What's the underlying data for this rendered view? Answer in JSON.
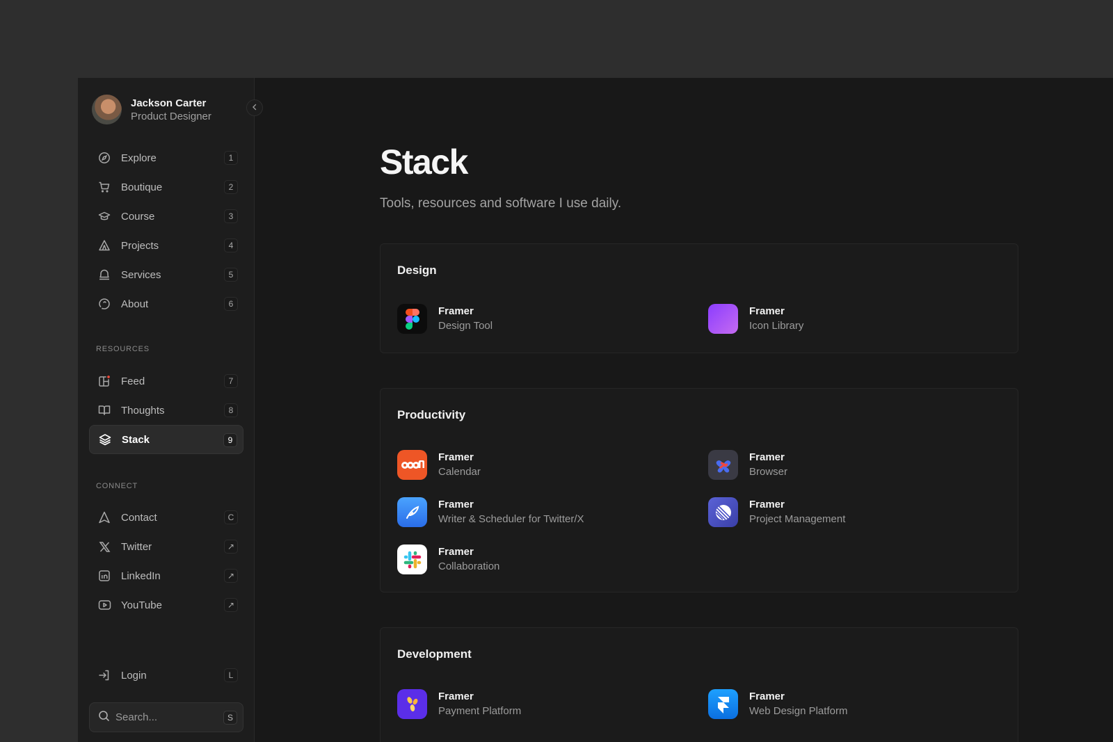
{
  "profile": {
    "name": "Jackson Carter",
    "role": "Product Designer"
  },
  "nav_main": [
    {
      "label": "Explore",
      "key": "1",
      "icon": "compass-icon"
    },
    {
      "label": "Boutique",
      "key": "2",
      "icon": "cart-icon"
    },
    {
      "label": "Course",
      "key": "3",
      "icon": "graduation-cap-icon"
    },
    {
      "label": "Projects",
      "key": "4",
      "icon": "tent-icon"
    },
    {
      "label": "Services",
      "key": "5",
      "icon": "bell-icon"
    },
    {
      "label": "About",
      "key": "6",
      "icon": "speech-icon"
    }
  ],
  "resources": {
    "title": "RESOURCES",
    "items": [
      {
        "label": "Feed",
        "key": "7",
        "icon": "feed-icon"
      },
      {
        "label": "Thoughts",
        "key": "8",
        "icon": "book-icon"
      },
      {
        "label": "Stack",
        "key": "9",
        "icon": "layers-icon",
        "active": true
      }
    ]
  },
  "connect": {
    "title": "CONNECT",
    "items": [
      {
        "label": "Contact",
        "key": "C",
        "icon": "send-icon"
      },
      {
        "label": "Twitter",
        "key": "↗",
        "icon": "x-icon"
      },
      {
        "label": "LinkedIn",
        "key": "↗",
        "icon": "linkedin-icon"
      },
      {
        "label": "YouTube",
        "key": "↗",
        "icon": "youtube-icon"
      }
    ]
  },
  "login": {
    "label": "Login",
    "key": "L"
  },
  "search": {
    "placeholder": "Search...",
    "key": "S"
  },
  "page": {
    "title": "Stack",
    "subtitle": "Tools, resources and software I use daily."
  },
  "sections": [
    {
      "title": "Design",
      "tools": [
        {
          "name": "Framer",
          "desc": "Design Tool",
          "icon": "figma-icon"
        },
        {
          "name": "Framer",
          "desc": "Icon Library",
          "icon": "gradient-square-icon"
        }
      ]
    },
    {
      "title": "Productivity",
      "tools": [
        {
          "name": "Framer",
          "desc": "Calendar",
          "icon": "calendar-app-icon"
        },
        {
          "name": "Framer",
          "desc": "Browser",
          "icon": "browser-app-icon"
        },
        {
          "name": "Framer",
          "desc": "Writer & Scheduler for Twitter/X",
          "icon": "feather-app-icon"
        },
        {
          "name": "Framer",
          "desc": "Project Management",
          "icon": "linear-app-icon"
        },
        {
          "name": "Framer",
          "desc": "Collaboration",
          "icon": "slack-app-icon"
        }
      ]
    },
    {
      "title": "Development",
      "tools": [
        {
          "name": "Framer",
          "desc": "Payment Platform",
          "icon": "payment-app-icon"
        },
        {
          "name": "Framer",
          "desc": "Web Design Platform",
          "icon": "framer-app-icon"
        }
      ]
    }
  ]
}
